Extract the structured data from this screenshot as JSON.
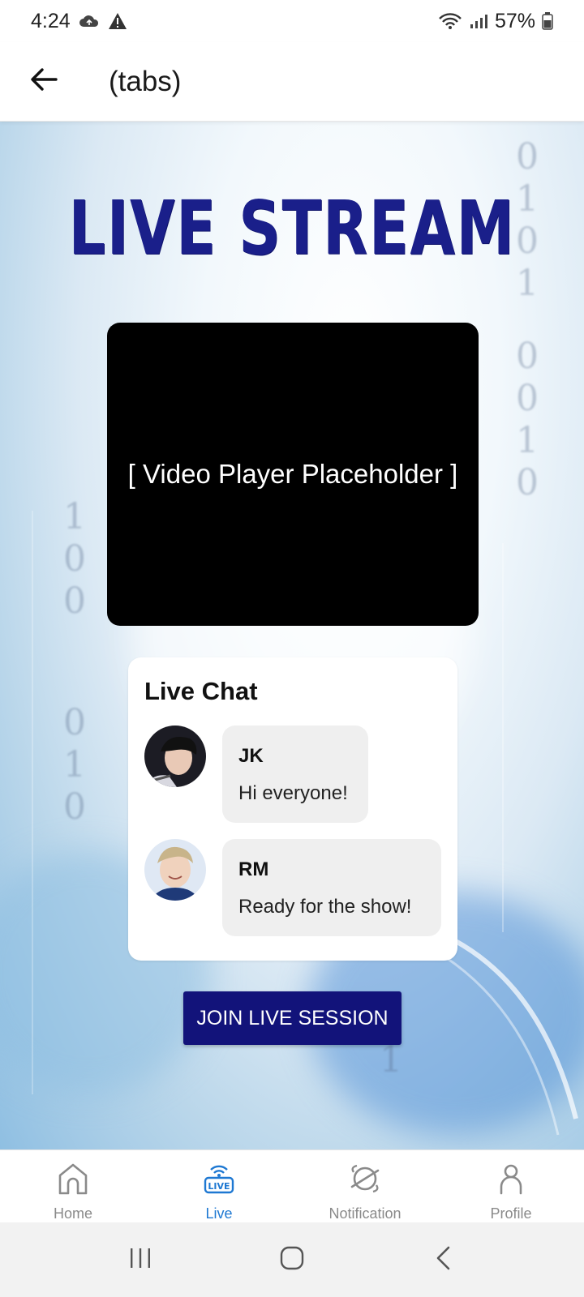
{
  "status_bar": {
    "time": "4:24",
    "battery": "57%"
  },
  "app_bar": {
    "title": "(tabs)"
  },
  "hero": {
    "title": "LIVE STREAM"
  },
  "video": {
    "placeholder": "[ Video Player Placeholder ]"
  },
  "chat": {
    "title": "Live Chat",
    "messages": [
      {
        "name": "JK",
        "text": "Hi everyone!"
      },
      {
        "name": "RM",
        "text": "Ready for the show!"
      }
    ]
  },
  "join_button": {
    "label": "JOIN LIVE SESSION"
  },
  "bottom_nav": {
    "items": [
      {
        "label": "Home",
        "icon": "home-icon"
      },
      {
        "label": "Live",
        "icon": "live-icon"
      },
      {
        "label": "Notification",
        "icon": "notification-icon"
      },
      {
        "label": "Profile",
        "icon": "profile-icon"
      }
    ],
    "active": "Live"
  },
  "colors": {
    "accent": "#1e78d2",
    "brand_navy": "#12137a",
    "title_navy": "#1a1f8a"
  }
}
